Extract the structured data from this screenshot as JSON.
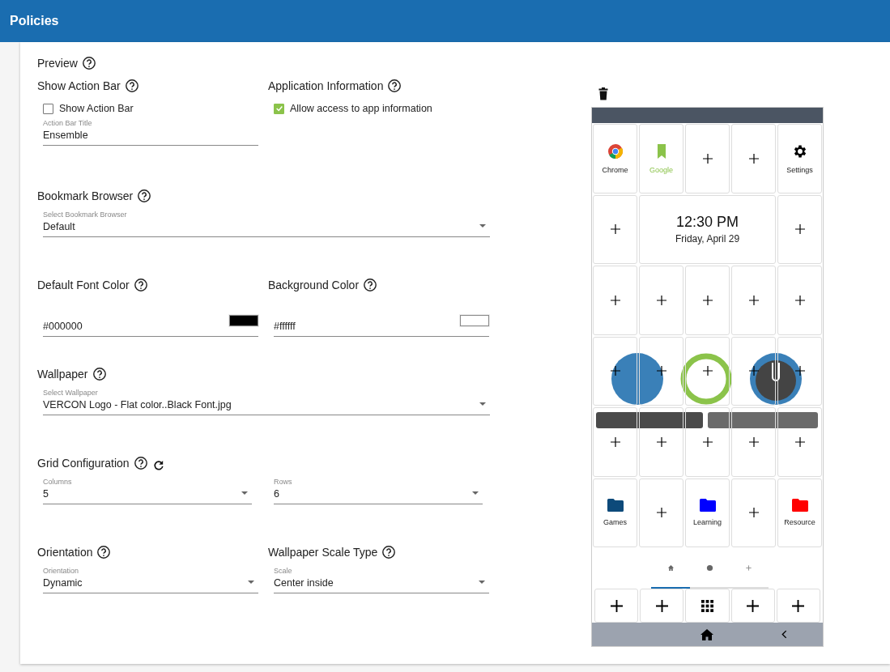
{
  "header": {
    "title": "Policies"
  },
  "preview": {
    "title": "Preview"
  },
  "action_bar": {
    "title": "Show Action Bar",
    "checkbox": {
      "label": "Show Action Bar",
      "checked": false
    },
    "title_field": {
      "label": "Action Bar Title",
      "value": "Ensemble"
    }
  },
  "app_info": {
    "title": "Application Information",
    "checkbox": {
      "label": "Allow access to app information",
      "checked": true
    }
  },
  "bookmark_browser": {
    "title": "Bookmark Browser",
    "select": {
      "label": "Select Bookmark Browser",
      "value": "Default"
    }
  },
  "font_color": {
    "title": "Default Font Color",
    "value": "#000000"
  },
  "background_color": {
    "title": "Background Color",
    "value": "#ffffff"
  },
  "wallpaper": {
    "title": "Wallpaper",
    "select": {
      "label": "Select Wallpaper",
      "value": "VERCON Logo - Flat color..Black Font.jpg"
    }
  },
  "grid_configuration": {
    "title": "Grid Configuration",
    "columns": {
      "label": "Columns",
      "value": "5"
    },
    "rows": {
      "label": "Rows",
      "value": "6"
    }
  },
  "orientation": {
    "title": "Orientation",
    "select": {
      "label": "Orientation",
      "value": "Dynamic"
    }
  },
  "wallpaper_scale": {
    "title": "Wallpaper Scale Type",
    "select": {
      "label": "Scale",
      "value": "Center inside"
    }
  },
  "phone": {
    "cells": [
      {
        "kind": "app",
        "label": "Chrome"
      },
      {
        "kind": "app",
        "label": "Google",
        "color": "#8bc34a"
      },
      {
        "kind": "add"
      },
      {
        "kind": "add"
      },
      {
        "kind": "app",
        "label": "Settings"
      },
      {
        "kind": "add"
      },
      {
        "kind": "clock",
        "time": "12:30 PM",
        "date": "Friday, April 29"
      },
      {
        "kind": "add"
      },
      {
        "kind": "add"
      },
      {
        "kind": "add"
      },
      {
        "kind": "add"
      },
      {
        "kind": "add"
      },
      {
        "kind": "add"
      },
      {
        "kind": "add"
      },
      {
        "kind": "add"
      },
      {
        "kind": "add"
      },
      {
        "kind": "add"
      },
      {
        "kind": "add"
      },
      {
        "kind": "add"
      },
      {
        "kind": "add"
      },
      {
        "kind": "add"
      },
      {
        "kind": "add"
      },
      {
        "kind": "add"
      },
      {
        "kind": "folder",
        "label": "Games",
        "color": "#0d4a7a"
      },
      {
        "kind": "add"
      },
      {
        "kind": "folder",
        "label": "Learning",
        "color": "#0000ff"
      },
      {
        "kind": "add"
      },
      {
        "kind": "folder",
        "label": "Resource",
        "color": "#ff0000"
      }
    ],
    "pages": [
      {
        "kind": "home",
        "selected": true
      },
      {
        "kind": "dot",
        "selected": false
      },
      {
        "kind": "add",
        "selected": false
      }
    ],
    "dock": [
      {
        "kind": "add"
      },
      {
        "kind": "add"
      },
      {
        "kind": "apps"
      },
      {
        "kind": "add"
      },
      {
        "kind": "add"
      }
    ]
  }
}
